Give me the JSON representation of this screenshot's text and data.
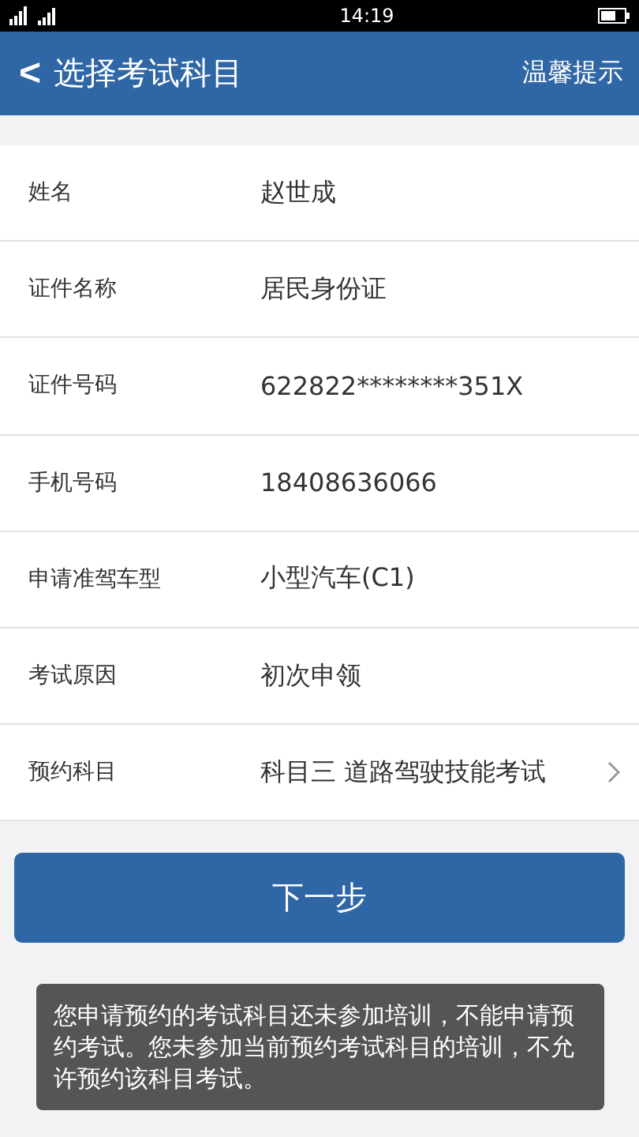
{
  "status_bar": {
    "time": "14:19"
  },
  "header": {
    "back": "<",
    "title": "选择考试科目",
    "action": "温馨提示"
  },
  "fields": [
    {
      "label": "姓名",
      "value": "赵世成",
      "kind": "text"
    },
    {
      "label": "证件名称",
      "value": "居民身份证",
      "kind": "text"
    },
    {
      "label": "证件号码",
      "value": "622822********351X",
      "kind": "text"
    },
    {
      "label": "手机号码",
      "value": "18408636066",
      "kind": "text"
    },
    {
      "label": "申请准驾车型",
      "value": "小型汽车(C1)",
      "kind": "text"
    },
    {
      "label": "考试原因",
      "value": "初次申领",
      "kind": "text"
    },
    {
      "label": "预约科目",
      "value": "科目三 道路驾驶技能考试",
      "kind": "select"
    }
  ],
  "next_button": "下一步",
  "toast": "您申请预约的考试科目还未参加培训，不能申请预约考试。您未参加当前预约考试科目的培训，不允许预约该科目考试。"
}
